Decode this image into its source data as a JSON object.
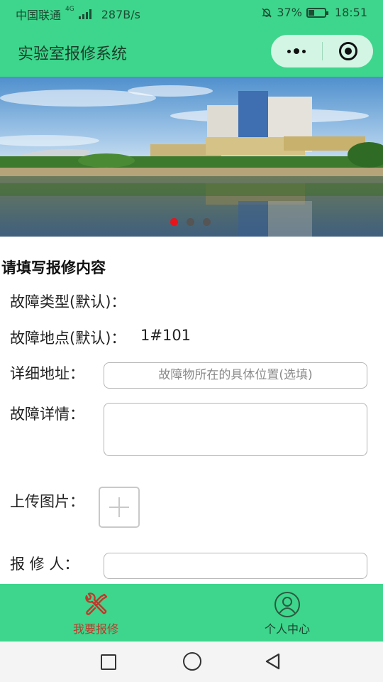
{
  "status_bar": {
    "carrier": "中国联通",
    "network_type": "4G",
    "speed": "287B/s",
    "battery": "37%",
    "battery_level": 0.37,
    "time": "18:51"
  },
  "header": {
    "title": "实验室报修系统"
  },
  "banner": {
    "slide_count": 3,
    "active_slide": 0
  },
  "form": {
    "section_title": "请填写报修内容",
    "fault_type_label": "故障类型(默认)：",
    "fault_type_value": "",
    "location_label": "故障地点(默认)：",
    "location_value": "1#101",
    "address_label": "详细地址：",
    "address_placeholder": "故障物所在的具体位置(选填)",
    "detail_label": "故障详情：",
    "upload_label": "上传图片：",
    "reporter_label": "报 修 人："
  },
  "tabbar": {
    "items": [
      {
        "label": "我要报修",
        "icon": "wrench-screwdriver-icon",
        "active": true
      },
      {
        "label": "个人中心",
        "icon": "user-icon",
        "active": false
      }
    ]
  },
  "colors": {
    "brand_green": "#3dd68c",
    "active_red": "#c0392b",
    "dot_active": "#e8141b"
  }
}
